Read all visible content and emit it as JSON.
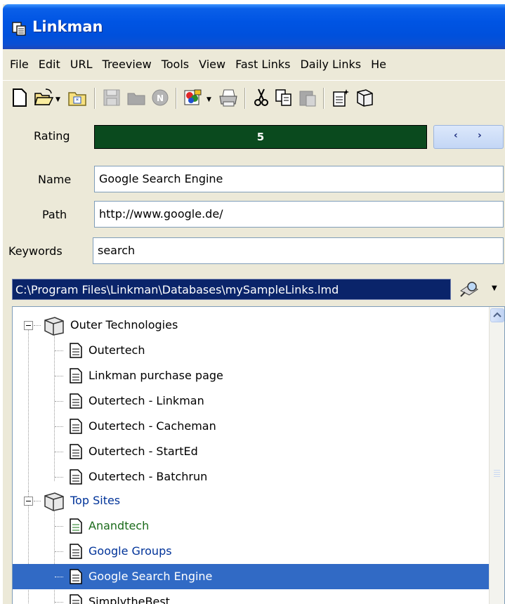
{
  "window": {
    "title": "Linkman"
  },
  "menu": [
    "File",
    "Edit",
    "URL",
    "Treeview",
    "Tools",
    "View",
    "Fast Links",
    "Daily Links",
    "He"
  ],
  "toolbar": {
    "icons": [
      "new-document-icon",
      "open-folder-icon",
      "open-dropdown-icon",
      "favorites-folder-icon",
      "save-icon",
      "folder-disabled-icon",
      "netscape-icon",
      "import-icon",
      "import-dropdown-icon",
      "print-icon",
      "cut-icon",
      "copy-icon",
      "paste-icon",
      "new-link-icon",
      "new-folder-icon"
    ]
  },
  "form": {
    "rating_label": "Rating",
    "rating_value": "5",
    "name_label": "Name",
    "name_value": "Google Search Engine",
    "path_label": "Path",
    "path_value": "http://www.google.de/",
    "keywords_label": "Keywords",
    "keywords_value": "search"
  },
  "database": {
    "path": "C:\\Program Files\\Linkman\\Databases\\mySampleLinks.lmd"
  },
  "tree": {
    "groups": [
      {
        "label": "Outer Technologies",
        "items": [
          "Outertech",
          "Linkman purchase page",
          "Outertech - Linkman",
          "Outertech - Cacheman",
          "Outertech - StartEd",
          "Outertech - Batchrun"
        ]
      },
      {
        "label": "Top Sites",
        "items": [
          "Anandtech",
          "Google Groups",
          "Google Search Engine",
          "SimplytheBest"
        ]
      }
    ],
    "selected": "Google Search Engine"
  },
  "colors": {
    "title_bar": "#0054e3",
    "rating_fill": "#0a4a1e",
    "selection": "#316ac5",
    "db_path_bg": "#0a246a"
  }
}
